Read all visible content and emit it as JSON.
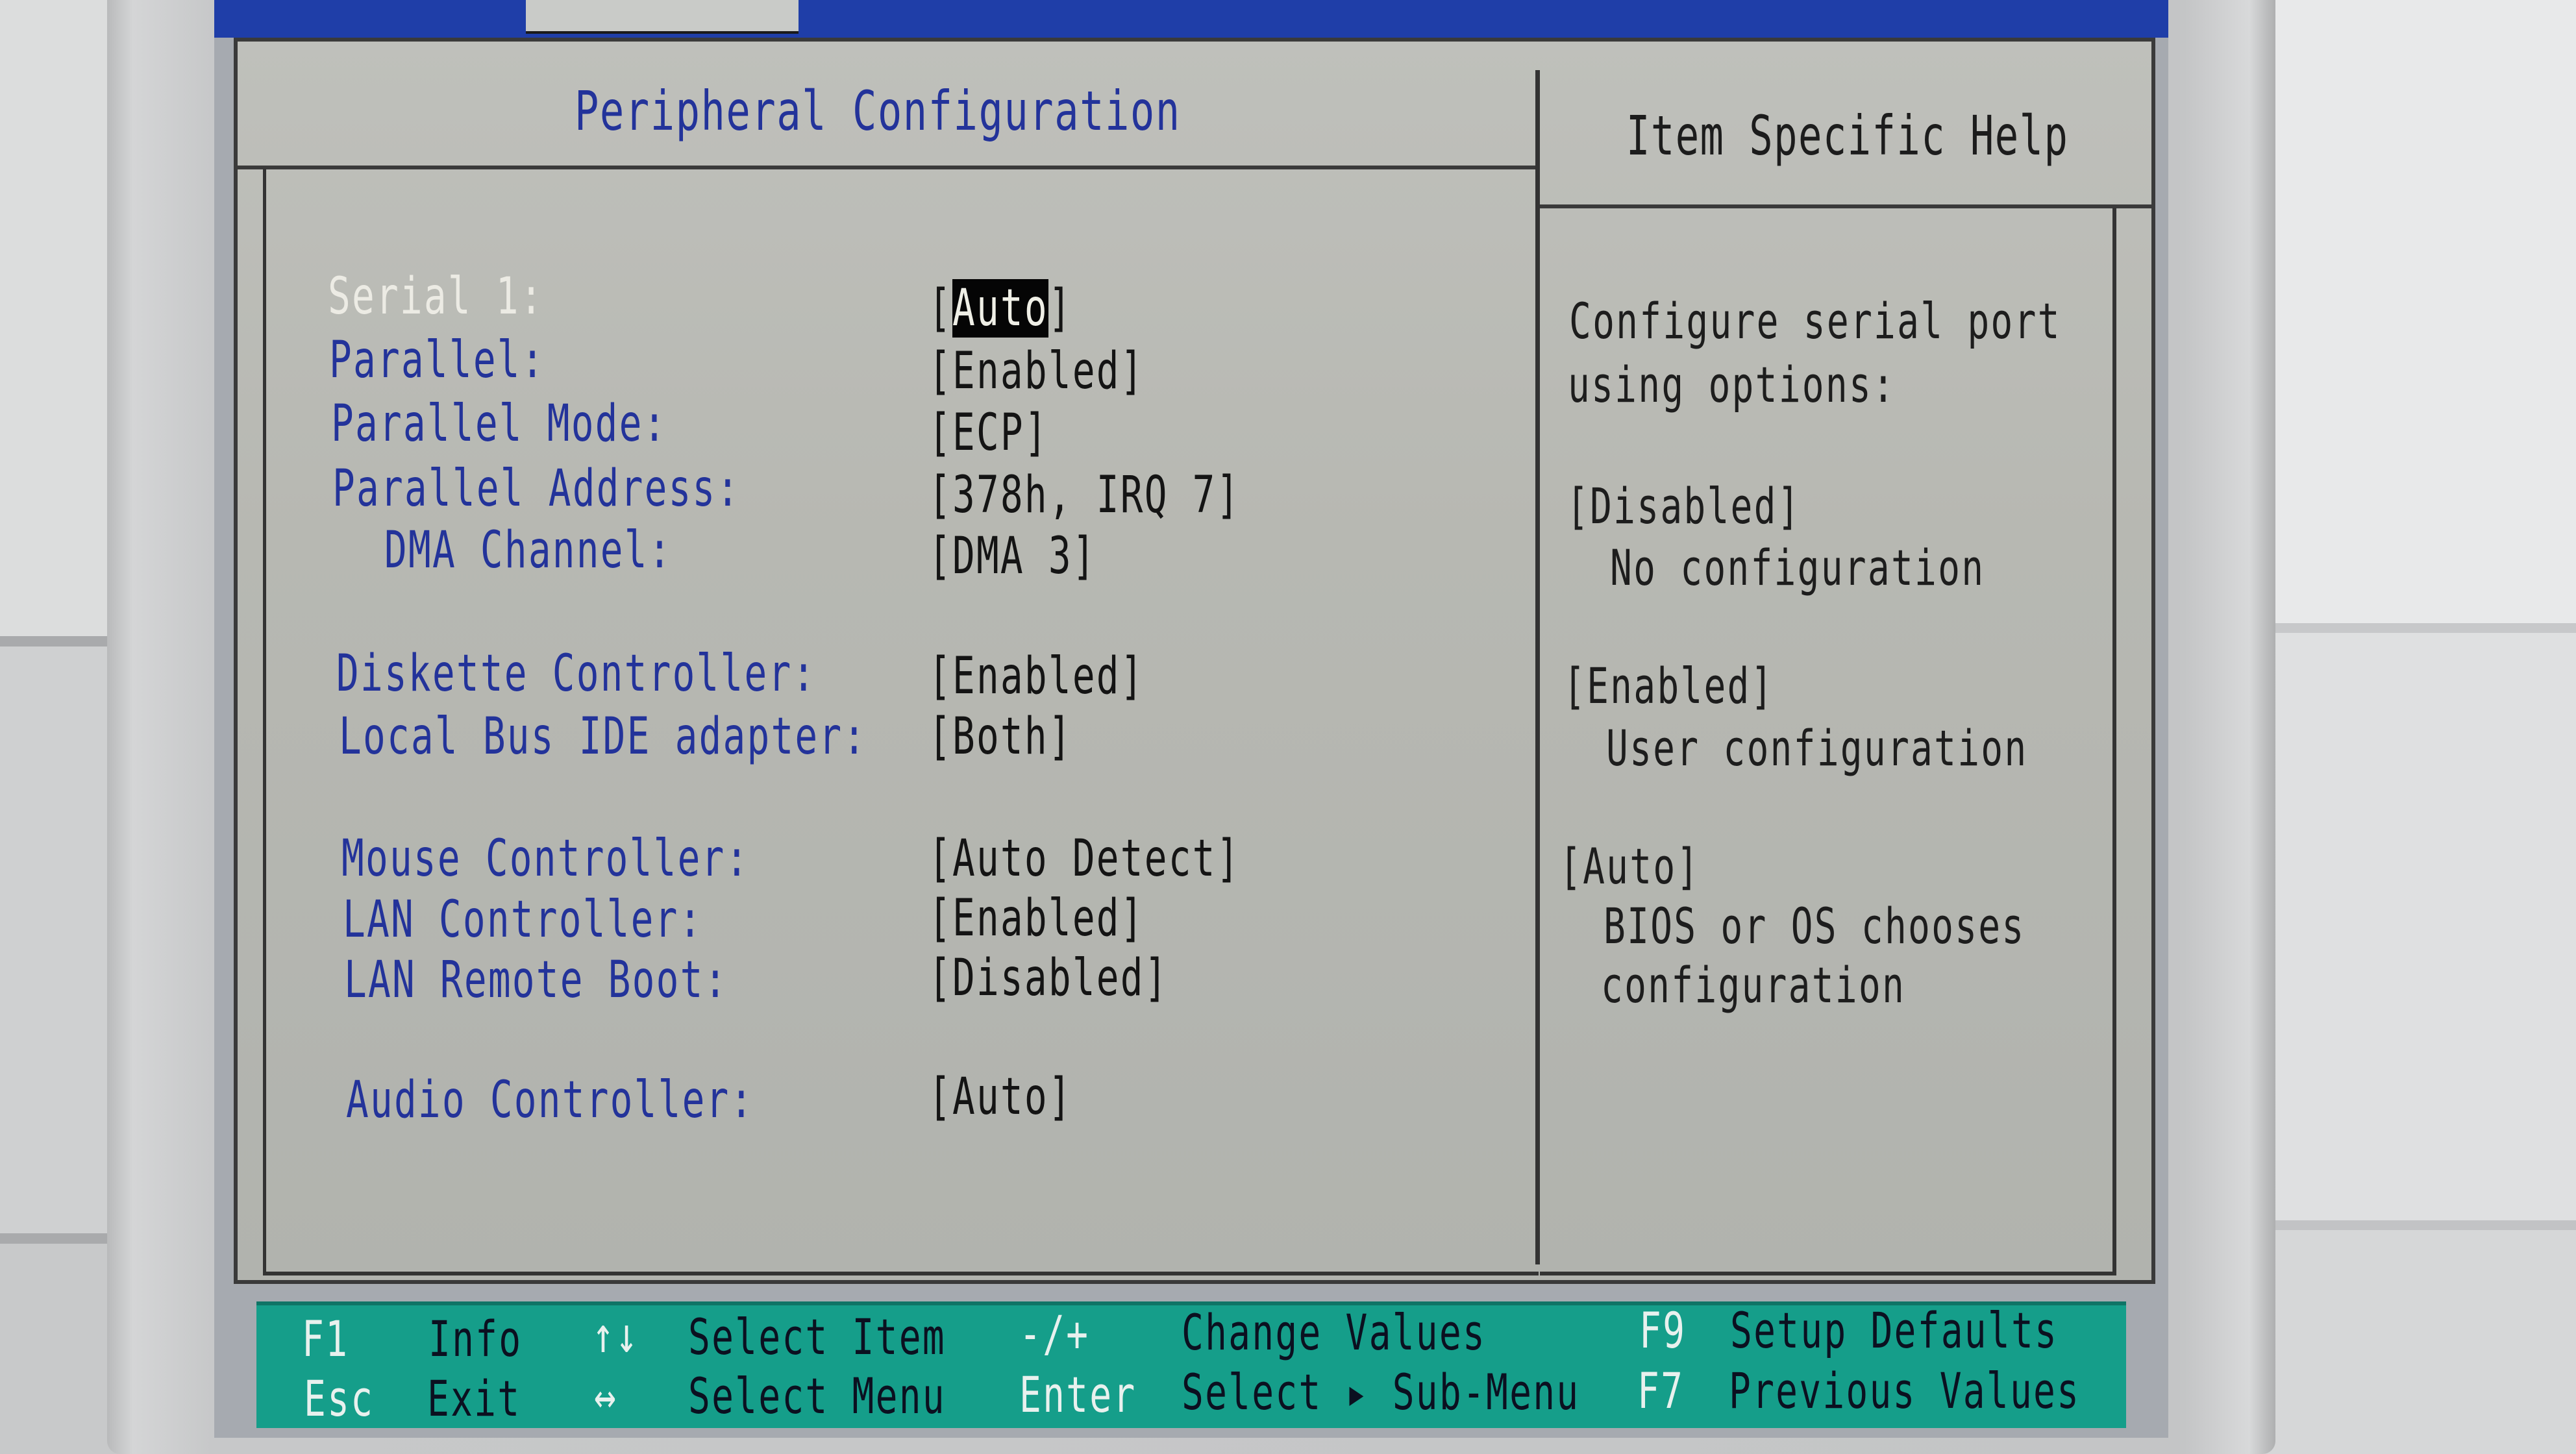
{
  "header": {
    "title": "Peripheral Configuration",
    "help_title": "Item Specific Help"
  },
  "settings": [
    {
      "label": "Serial 1:",
      "value_prefix": "[",
      "value_highlight": "Auto",
      "value_suffix": "]",
      "selected": true
    },
    {
      "label": "Parallel:",
      "value": "[Enabled]"
    },
    {
      "label": "Parallel Mode:",
      "value": "[ECP]"
    },
    {
      "label": "Parallel Address:",
      "value": "[378h, IRQ 7]"
    },
    {
      "label": "DMA Channel:",
      "value": "[DMA 3]"
    },
    {
      "label": "Diskette Controller:",
      "value": "[Enabled]"
    },
    {
      "label": "Local Bus IDE adapter:",
      "value": "[Both]"
    },
    {
      "label": "Mouse Controller:",
      "value": "[Auto Detect]"
    },
    {
      "label": "LAN Controller:",
      "value": "[Enabled]"
    },
    {
      "label": "LAN Remote Boot:",
      "value": "[Disabled]"
    },
    {
      "label": "Audio Controller:",
      "value": "[Auto]"
    }
  ],
  "help_lines": [
    "Configure serial port",
    "using options:",
    "[Disabled]",
    "No configuration",
    "[Enabled]",
    "User configuration",
    "[Auto]",
    "BIOS or OS chooses",
    "configuration"
  ],
  "keys": {
    "f1": "F1",
    "f1_text": "Info",
    "updown": "↑↓",
    "updown_text": "Select Item",
    "minusplus": "-/+",
    "minusplus_text": "Change Values",
    "f9": "F9",
    "f9_text": "Setup Defaults",
    "esc": "Esc",
    "esc_text": "Exit",
    "leftright": "↔",
    "leftright_text": "Select Menu",
    "enter": "Enter",
    "enter_text": "Select ▸ Sub-Menu",
    "f7": "F7",
    "f7_text": "Previous Values"
  },
  "colors": {
    "label_blue": "#23339a",
    "keybar_teal": "#159e8a",
    "panel_grey": "#b7b8b2"
  }
}
